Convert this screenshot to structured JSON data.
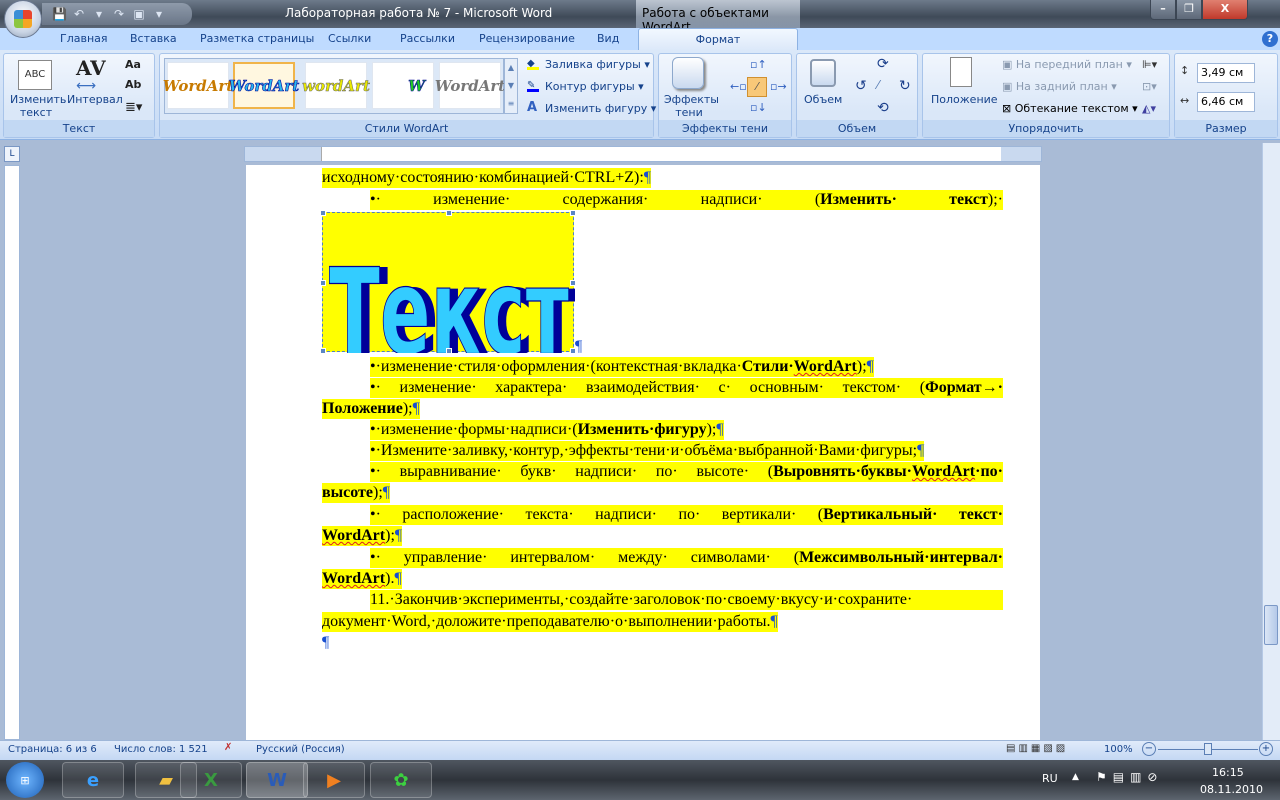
{
  "window": {
    "title": "Лабораторная работа № 7 - Microsoft Word",
    "context_title": "Работа с объектами WordArt",
    "minimize": "–",
    "restore": "❐",
    "close": "X"
  },
  "tabs": [
    "Главная",
    "Вставка",
    "Разметка страницы",
    "Ссылки",
    "Рассылки",
    "Рецензирование",
    "Вид"
  ],
  "active_tab": "Формат",
  "help": "?",
  "ribbon": {
    "text_group": {
      "label": "Текст",
      "edit_text": "Изменить текст",
      "edit_text_l1": "Изменить",
      "edit_text_l2": "текст",
      "spacing": "Интервал",
      "spacing_glyph": "AV",
      "same_height": "Aa",
      "vertical": "Ab"
    },
    "styles_group": {
      "label": "Стили WordArt",
      "thumbs": [
        "WordArt",
        "WordArt",
        "wordArt",
        "W",
        "WordArt"
      ],
      "fill": "Заливка фигуры",
      "outline": "Контур фигуры",
      "change_shape": "Изменить фигуру"
    },
    "shadow_group": {
      "label": "Эффекты тени",
      "button_l1": "Эффекты",
      "button_l2": "тени"
    },
    "volume_group": {
      "label": "Объем",
      "button": "Объем"
    },
    "arrange_group": {
      "label": "Упорядочить",
      "position": "Положение",
      "front": "На передний план",
      "back": "На задний план",
      "wrap": "Обтекание текстом"
    },
    "size_group": {
      "label": "Размер",
      "height": "3,49 см",
      "width": "6,46 см"
    }
  },
  "ruler_corner": "L",
  "document": {
    "wordart_text": "Текст",
    "lines": [
      [
        {
          "t": "исходному·состоянию·комбинацией·CTRL+Z):"
        },
        {
          "t": "¶",
          "p": 1
        }
      ],
      [
        {
          "t": "•·      изменение·      содержания·      надписи·      ("
        },
        {
          "t": "Изменить·      текст",
          "b": 1
        },
        {
          "t": ");·"
        }
      ],
      [
        {
          "t": "¶",
          "p": 1
        }
      ],
      [
        {
          "t": "•·изменение·стиля·оформления·(контекстная·вкладка·"
        },
        {
          "t": "Стили·",
          "b": 1
        },
        {
          "t": "WordArt",
          "b": 1,
          "s": 1
        },
        {
          "t": ");"
        },
        {
          "t": "¶",
          "p": 1
        }
      ],
      [
        {
          "t": "•·  изменение·  характера·  взаимодействия·  с·  основным·  текстом·  ("
        },
        {
          "t": "Формат→·",
          "b": 1
        }
      ],
      [
        {
          "t": "Положение",
          "b": 1
        },
        {
          "t": ");"
        },
        {
          "t": "¶",
          "p": 1
        }
      ],
      [
        {
          "t": "•·изменение·формы·надписи·("
        },
        {
          "t": "Изменить·фигуру",
          "b": 1
        },
        {
          "t": ");"
        },
        {
          "t": "¶",
          "p": 1
        }
      ],
      [
        {
          "t": "•·Измените·заливку,·контур,·эффекты·тени·и·объёма·выбранной·Вами·фигуры;"
        },
        {
          "t": "¶",
          "p": 1
        }
      ],
      [
        {
          "t": "•·  выравнивание·  букв·  надписи·  по·  высоте·  ("
        },
        {
          "t": "Выровнять·буквы·",
          "b": 1
        },
        {
          "t": "WordArt",
          "b": 1,
          "s": 1
        },
        {
          "t": "·по·",
          "b": 1
        }
      ],
      [
        {
          "t": "высоте",
          "b": 1
        },
        {
          "t": ");"
        },
        {
          "t": "¶",
          "p": 1
        }
      ],
      [
        {
          "t": "•·  расположение·  текста·  надписи·  по·  вертикали·  ("
        },
        {
          "t": "Вертикальный·  текст·",
          "b": 1
        }
      ],
      [
        {
          "t": "WordArt",
          "b": 1,
          "s": 1
        },
        {
          "t": ");"
        },
        {
          "t": "¶",
          "p": 1
        }
      ],
      [
        {
          "t": "•·  управление·  интервалом·  между·  символами·  ("
        },
        {
          "t": "Межсимвольный·интервал·",
          "b": 1
        }
      ],
      [
        {
          "t": "WordArt",
          "b": 1,
          "s": 1
        },
        {
          "t": ")."
        },
        {
          "t": "¶",
          "p": 1
        }
      ],
      [
        {
          "t": "11.·Закончив·эксперименты,·создайте·заголовок·по·своему·вкусу·и·сохраните·"
        }
      ],
      [
        {
          "t": "документ·Word,·доложите·преподавателю·о·выполнении·работы."
        },
        {
          "t": "¶",
          "p": 1
        }
      ],
      [
        {
          "t": "¶",
          "p": 1
        }
      ]
    ]
  },
  "status": {
    "page": "Страница: 6 из 6",
    "words": "Число слов: 1 521",
    "language": "Русский (Россия)",
    "zoom": "100%",
    "zoom_out": "−",
    "zoom_in": "+"
  },
  "taskbar": {
    "lang": "RU",
    "time": "16:15",
    "date": "08.11.2010",
    "apps": [
      "internet-explorer",
      "explorer",
      "excel",
      "word",
      "media-player",
      "icq"
    ]
  },
  "colors": {
    "highlight": "#ffff00",
    "wordart_fill": "#33ccff",
    "wordart_shadow": "#000099",
    "ribbon_bg": "#dbe8f9"
  }
}
